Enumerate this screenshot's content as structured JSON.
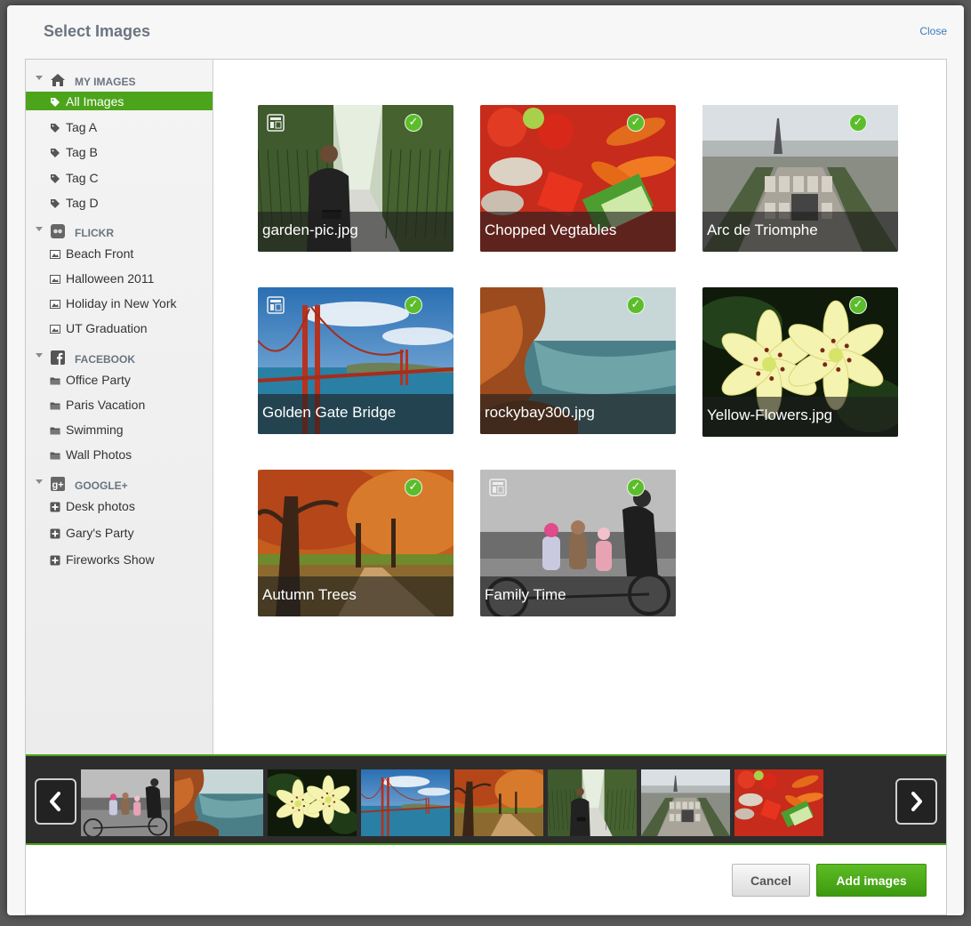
{
  "dialog": {
    "title": "Select Images",
    "close_label": "Close"
  },
  "sidebar": {
    "groups": [
      {
        "label": "MY IMAGES",
        "icon": "home-icon",
        "items": [
          {
            "label": "All Images",
            "icon": "tag-icon",
            "active": true
          },
          {
            "label": "Tag A",
            "icon": "tag-icon"
          },
          {
            "label": "Tag B",
            "icon": "tag-icon"
          },
          {
            "label": "Tag C",
            "icon": "tag-icon"
          },
          {
            "label": "Tag D",
            "icon": "tag-icon"
          }
        ]
      },
      {
        "label": "FLICKR",
        "icon": "flickr-icon",
        "items": [
          {
            "label": "Beach Front",
            "icon": "image-icon"
          },
          {
            "label": "Halloween 2011",
            "icon": "image-icon"
          },
          {
            "label": "Holiday in New York",
            "icon": "image-icon"
          },
          {
            "label": "UT Graduation",
            "icon": "image-icon"
          }
        ]
      },
      {
        "label": "FACEBOOK",
        "icon": "facebook-icon",
        "items": [
          {
            "label": "Office Party",
            "icon": "folder-icon"
          },
          {
            "label": "Paris Vacation",
            "icon": "folder-icon"
          },
          {
            "label": "Swimming",
            "icon": "folder-icon"
          },
          {
            "label": "Wall Photos",
            "icon": "folder-icon"
          }
        ]
      },
      {
        "label": "GOOGLE+",
        "icon": "google-plus-icon",
        "items": [
          {
            "label": "Desk photos",
            "icon": "plus-box-icon"
          },
          {
            "label": "Gary's Party",
            "icon": "plus-box-icon"
          },
          {
            "label": "Fireworks Show",
            "icon": "plus-box-icon"
          }
        ]
      }
    ]
  },
  "images": [
    {
      "caption": "garden-pic.jpg",
      "selected": true,
      "template_icon": true
    },
    {
      "caption": "Chopped Vegtables",
      "selected": true,
      "template_icon": false
    },
    {
      "caption": "Arc de Triomphe",
      "selected": true,
      "template_icon": false
    },
    {
      "caption": "Golden Gate Bridge",
      "selected": true,
      "template_icon": true
    },
    {
      "caption": "rockybay300.jpg",
      "selected": true,
      "template_icon": false
    },
    {
      "caption": "Yellow-Flowers.jpg",
      "selected": true,
      "template_icon": false
    },
    {
      "caption": "Autumn Trees",
      "selected": true,
      "template_icon": false
    },
    {
      "caption": "Family Time",
      "selected": true,
      "template_icon": true
    }
  ],
  "filmstrip": {
    "prev_icon": "chevron-left-icon",
    "next_icon": "chevron-right-icon",
    "thumbs": [
      "Family Time",
      "rockybay300.jpg",
      "Yellow-Flowers.jpg",
      "Golden Gate Bridge",
      "Autumn Trees",
      "garden-pic.jpg",
      "Arc de Triomphe",
      "Chopped Vegtables"
    ]
  },
  "footer": {
    "cancel_label": "Cancel",
    "add_label": "Add images"
  },
  "colors": {
    "accent": "#4ca41a",
    "check": "#5cbd2c",
    "link": "#3a7bbf"
  }
}
